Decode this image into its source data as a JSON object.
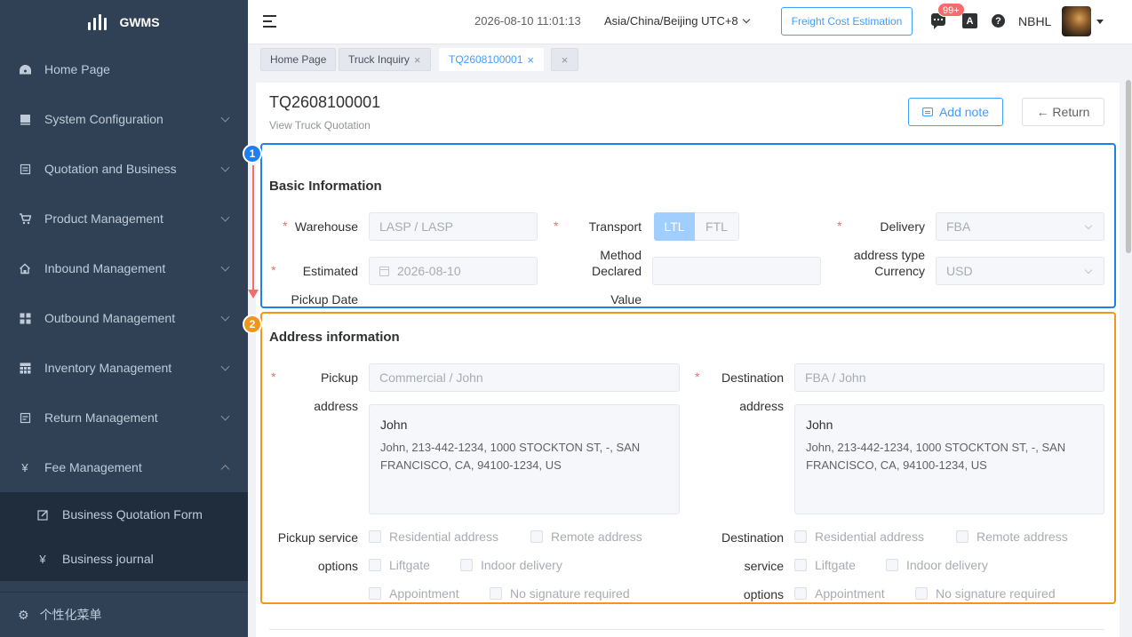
{
  "app": {
    "name": "GWMS"
  },
  "sidebar": {
    "items": [
      {
        "label": "Home Page",
        "icon": "dashboard-icon"
      },
      {
        "label": "System Configuration",
        "icon": "config-icon"
      },
      {
        "label": "Quotation and Business",
        "icon": "quotation-icon"
      },
      {
        "label": "Product Management",
        "icon": "cart-icon"
      },
      {
        "label": "Inbound Management",
        "icon": "home-icon"
      },
      {
        "label": "Outbound Management",
        "icon": "grid-icon"
      },
      {
        "label": "Inventory Management",
        "icon": "table-icon"
      },
      {
        "label": "Return Management",
        "icon": "return-icon"
      },
      {
        "label": "Fee Management",
        "icon": "yen-icon"
      }
    ],
    "sub_items": [
      {
        "label": "Business Quotation Form",
        "icon": "edit-icon"
      },
      {
        "label": "Business journal",
        "icon": "yen-icon"
      }
    ],
    "bottom": {
      "label": "个性化菜单",
      "icon": "gear-icon"
    }
  },
  "header": {
    "datetime": "2026-08-10 11:01:13",
    "timezone": "Asia/China/Beijing UTC+8",
    "freight_button": "Freight Cost Estimation",
    "badge": "99+",
    "lang_glyph": "A",
    "help_glyph": "?",
    "username": "NBHL"
  },
  "tabs": [
    {
      "label": "Home Page"
    },
    {
      "label": "Truck Inquiry"
    },
    {
      "label": "TQ2608100001"
    }
  ],
  "tab_close": "×",
  "page": {
    "title": "TQ2608100001",
    "subtitle": "View Truck Quotation",
    "add_note": "Add note",
    "return": "← Return"
  },
  "markers": {
    "one": "1",
    "two": "2"
  },
  "basic": {
    "title": "Basic Information",
    "warehouse_label": "Warehouse",
    "warehouse_value": "LASP / LASP",
    "transport_label": "Transport",
    "transport_options": [
      "LTL",
      "FTL"
    ],
    "transport_selected": "LTL",
    "delivery_label_1": "Delivery",
    "delivery_label_2": "address type",
    "delivery_value": "FBA",
    "estimated_label_1": "Estimated",
    "estimated_label_2": "Pickup Date",
    "estimated_value": "2026-08-10",
    "declared_label_1": "Method",
    "declared_label_2": "Declared",
    "declared_label_3": "Value",
    "declared_value": "",
    "currency_label": "Currency",
    "currency_value": "USD"
  },
  "address": {
    "title": "Address information",
    "pickup_label_1": "Pickup",
    "pickup_label_2": "address",
    "pickup_value": "Commercial / John",
    "pickup_name": "John",
    "pickup_line_1": "John, 213-442-1234, 1000 STOCKTON ST, -, SAN",
    "pickup_line_2": "FRANCISCO, CA, 94100-1234, US",
    "dest_label_1": "Destination",
    "dest_label_2": "address",
    "dest_value": "FBA / John",
    "dest_name": "John",
    "dest_line_1": "John, 213-442-1234, 1000 STOCKTON ST, -, SAN",
    "dest_line_2": "FRANCISCO, CA, 94100-1234, US",
    "pickup_service_label_1": "Pickup service",
    "pickup_service_label_2": "options",
    "dest_service_label_1": "Destination",
    "dest_service_label_2": "service",
    "dest_service_label_3": "options",
    "options": [
      "Residential address",
      "Remote address",
      "Liftgate",
      "Indoor delivery",
      "Appointment",
      "No signature required"
    ]
  },
  "required_mark": "*",
  "colors": {
    "primary": "#409eff",
    "sidebar": "#304156",
    "annotation_blue": "#1e7ff0",
    "annotation_orange": "#f0961e",
    "arrow": "#f56c6c"
  }
}
